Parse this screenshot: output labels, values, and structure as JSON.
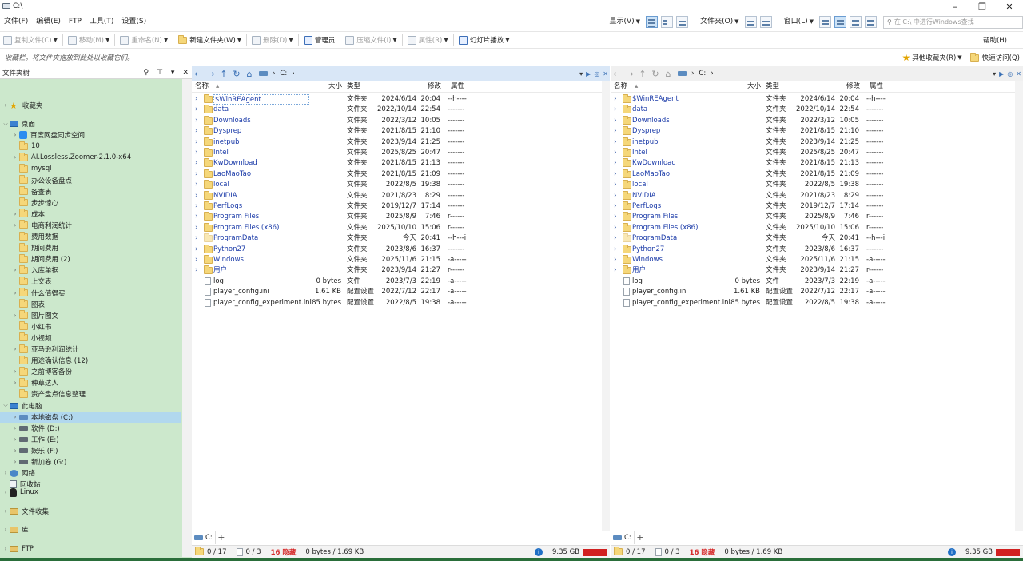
{
  "window": {
    "title": "C:\\"
  },
  "menu": {
    "items": [
      "文件(F)",
      "编辑(E)",
      "FTP",
      "工具(T)",
      "设置(S)"
    ],
    "right": {
      "view_label": "显示(V)",
      "folder_label": "文件夹(O)",
      "window_label": "窗口(L)",
      "search_placeholder": "在 C:\\ 中进行Windows查找"
    }
  },
  "toolbar": {
    "copy": "复制文件(C)",
    "move": "移动(M)",
    "rename": "重命名(N)",
    "newfolder": "新建文件夹(W)",
    "delete": "删除(D)",
    "admin": "管理员",
    "compress": "压缩文件(I)",
    "props": "属性(R)",
    "slideshow": "幻灯片播放",
    "help": "帮助(H)"
  },
  "favbar": {
    "hint": "收藏栏。将文件夹拖放到此处以收藏它们。",
    "other_fav": "其他收藏夹(R)",
    "quick_access": "快速访问(Q)"
  },
  "tree": {
    "header": "文件夹树",
    "items": [
      {
        "label": "收藏夹",
        "icon": "star-icon",
        "indent": 0,
        "arrow": "›"
      },
      {
        "label": "桌面",
        "icon": "desktop-icon",
        "indent": 0,
        "arrow": "⌄"
      },
      {
        "label": "百度网盘同步空间",
        "icon": "baidu-icon",
        "indent": 1,
        "arrow": "›"
      },
      {
        "label": "10",
        "icon": "folder-icon",
        "indent": 1,
        "arrow": ""
      },
      {
        "label": "AI.Lossless.Zoomer-2.1.0-x64",
        "icon": "folder-icon",
        "indent": 1,
        "arrow": "›"
      },
      {
        "label": "mysql",
        "icon": "folder-icon",
        "indent": 1,
        "arrow": ""
      },
      {
        "label": "办公设备盘点",
        "icon": "folder-icon",
        "indent": 1,
        "arrow": ""
      },
      {
        "label": "备查表",
        "icon": "folder-icon",
        "indent": 1,
        "arrow": ""
      },
      {
        "label": "步步惊心",
        "icon": "folder-icon",
        "indent": 1,
        "arrow": ""
      },
      {
        "label": "成本",
        "icon": "folder-icon",
        "indent": 1,
        "arrow": "›"
      },
      {
        "label": "电商利润统计",
        "icon": "folder-icon",
        "indent": 1,
        "arrow": "›"
      },
      {
        "label": "费用数据",
        "icon": "folder-icon",
        "indent": 1,
        "arrow": ""
      },
      {
        "label": "期间费用",
        "icon": "folder-icon",
        "indent": 1,
        "arrow": ""
      },
      {
        "label": "期间费用 (2)",
        "icon": "folder-icon",
        "indent": 1,
        "arrow": ""
      },
      {
        "label": "入库单据",
        "icon": "folder-icon",
        "indent": 1,
        "arrow": "›"
      },
      {
        "label": "上交表",
        "icon": "folder-icon",
        "indent": 1,
        "arrow": ""
      },
      {
        "label": "什么值得买",
        "icon": "folder-icon",
        "indent": 1,
        "arrow": "›"
      },
      {
        "label": "图表",
        "icon": "folder-icon",
        "indent": 1,
        "arrow": ""
      },
      {
        "label": "图片图文",
        "icon": "folder-icon",
        "indent": 1,
        "arrow": "›"
      },
      {
        "label": "小红书",
        "icon": "folder-icon",
        "indent": 1,
        "arrow": ""
      },
      {
        "label": "小视频",
        "icon": "folder-icon",
        "indent": 1,
        "arrow": ""
      },
      {
        "label": "亚马逊利润统计",
        "icon": "folder-icon",
        "indent": 1,
        "arrow": "›"
      },
      {
        "label": "用途确认信息 (12)",
        "icon": "folder-icon",
        "indent": 1,
        "arrow": ""
      },
      {
        "label": "之前博客备份",
        "icon": "folder-icon",
        "indent": 1,
        "arrow": "›"
      },
      {
        "label": "种草达人",
        "icon": "folder-icon",
        "indent": 1,
        "arrow": "›"
      },
      {
        "label": "资产盘点信息整理",
        "icon": "folder-icon",
        "indent": 1,
        "arrow": ""
      },
      {
        "label": "此电脑",
        "icon": "pc-icon",
        "indent": 0,
        "arrow": "⌄"
      },
      {
        "label": "本地磁盘 (C:)",
        "icon": "drive-c-icon",
        "indent": 1,
        "arrow": "›",
        "selected": true
      },
      {
        "label": "软件 (D:)",
        "icon": "drive-icon",
        "indent": 1,
        "arrow": "›"
      },
      {
        "label": "工作 (E:)",
        "icon": "drive-icon",
        "indent": 1,
        "arrow": "›"
      },
      {
        "label": "娱乐 (F:)",
        "icon": "drive-icon",
        "indent": 1,
        "arrow": "›"
      },
      {
        "label": "新加卷 (G:)",
        "icon": "drive-icon",
        "indent": 1,
        "arrow": "›"
      },
      {
        "label": "网络",
        "icon": "network-icon",
        "indent": 0,
        "arrow": "›"
      },
      {
        "label": "回收站",
        "icon": "recycle-bin-icon",
        "indent": 0,
        "arrow": ""
      }
    ],
    "bottom_items": [
      {
        "label": "Linux",
        "icon": "linux-icon"
      },
      {
        "label": "文件收集",
        "icon": "collection-icon"
      },
      {
        "label": "库",
        "icon": "library-icon"
      },
      {
        "label": "FTP",
        "icon": "ftp-icon"
      }
    ]
  },
  "columns": {
    "name": "名称",
    "size": "大小",
    "type": "类型",
    "modified": "修改",
    "attr": "属性"
  },
  "path": "C:",
  "files": [
    {
      "name": "$WinREAgent",
      "size": "",
      "type": "文件夹",
      "date": "2024/6/14",
      "time": "20:04",
      "attr": "--h----",
      "kind": "folder"
    },
    {
      "name": "data",
      "size": "",
      "type": "文件夹",
      "date": "2022/10/14",
      "time": "22:54",
      "attr": "-------",
      "kind": "folder"
    },
    {
      "name": "Downloads",
      "size": "",
      "type": "文件夹",
      "date": "2022/3/12",
      "time": "10:05",
      "attr": "-------",
      "kind": "folder"
    },
    {
      "name": "Dysprep",
      "size": "",
      "type": "文件夹",
      "date": "2021/8/15",
      "time": "21:10",
      "attr": "-------",
      "kind": "folder"
    },
    {
      "name": "inetpub",
      "size": "",
      "type": "文件夹",
      "date": "2023/9/14",
      "time": "21:25",
      "attr": "-------",
      "kind": "folder"
    },
    {
      "name": "Intel",
      "size": "",
      "type": "文件夹",
      "date": "2025/8/25",
      "time": "20:47",
      "attr": "-------",
      "kind": "folder"
    },
    {
      "name": "KwDownload",
      "size": "",
      "type": "文件夹",
      "date": "2021/8/15",
      "time": "21:13",
      "attr": "-------",
      "kind": "folder"
    },
    {
      "name": "LaoMaoTao",
      "size": "",
      "type": "文件夹",
      "date": "2021/8/15",
      "time": "21:09",
      "attr": "-------",
      "kind": "folder"
    },
    {
      "name": "local",
      "size": "",
      "type": "文件夹",
      "date": "2022/8/5",
      "time": "19:38",
      "attr": "-------",
      "kind": "folder"
    },
    {
      "name": "NVIDIA",
      "size": "",
      "type": "文件夹",
      "date": "2021/8/23",
      "time": "8:29",
      "attr": "-------",
      "kind": "folder"
    },
    {
      "name": "PerfLogs",
      "size": "",
      "type": "文件夹",
      "date": "2019/12/7",
      "time": "17:14",
      "attr": "-------",
      "kind": "folder"
    },
    {
      "name": "Program Files",
      "size": "",
      "type": "文件夹",
      "date": "2025/8/9",
      "time": "7:46",
      "attr": "r------",
      "kind": "folder"
    },
    {
      "name": "Program Files (x86)",
      "size": "",
      "type": "文件夹",
      "date": "2025/10/10",
      "time": "15:06",
      "attr": "r------",
      "kind": "folder"
    },
    {
      "name": "ProgramData",
      "size": "",
      "type": "文件夹",
      "date": "今天",
      "time": "20:41",
      "attr": "--h---i",
      "kind": "folder-hidden"
    },
    {
      "name": "Python27",
      "size": "",
      "type": "文件夹",
      "date": "2023/8/6",
      "time": "16:37",
      "attr": "-------",
      "kind": "folder"
    },
    {
      "name": "Windows",
      "size": "",
      "type": "文件夹",
      "date": "2025/11/6",
      "time": "21:15",
      "attr": "-a-----",
      "kind": "folder"
    },
    {
      "name": "用户",
      "size": "",
      "type": "文件夹",
      "date": "2023/9/14",
      "time": "21:27",
      "attr": "r------",
      "kind": "folder"
    },
    {
      "name": "log",
      "size": "0 bytes",
      "type": "文件",
      "date": "2023/7/3",
      "time": "22:19",
      "attr": "-a-----",
      "kind": "file"
    },
    {
      "name": "player_config.ini",
      "size": "1.61 KB",
      "type": "配置设置",
      "date": "2022/7/12",
      "time": "22:17",
      "attr": "-a-----",
      "kind": "ini"
    },
    {
      "name": "player_config_experiment.ini",
      "size": "85 bytes",
      "type": "配置设置",
      "date": "2022/8/5",
      "time": "19:38",
      "attr": "-a-----",
      "kind": "ini"
    }
  ],
  "tab": {
    "label": "C:"
  },
  "status": {
    "folders": "0 / 17",
    "files": "0 / 3",
    "hidden": "16 隐藏",
    "size": "0 bytes / 1.69 KB",
    "free": "9.35 GB"
  },
  "colors": {
    "tree_bg": "#cce8cc",
    "active_addr": "#d9e7f7",
    "hidden_red": "#d62b2b",
    "folder_yellow": "#f5d77a"
  }
}
